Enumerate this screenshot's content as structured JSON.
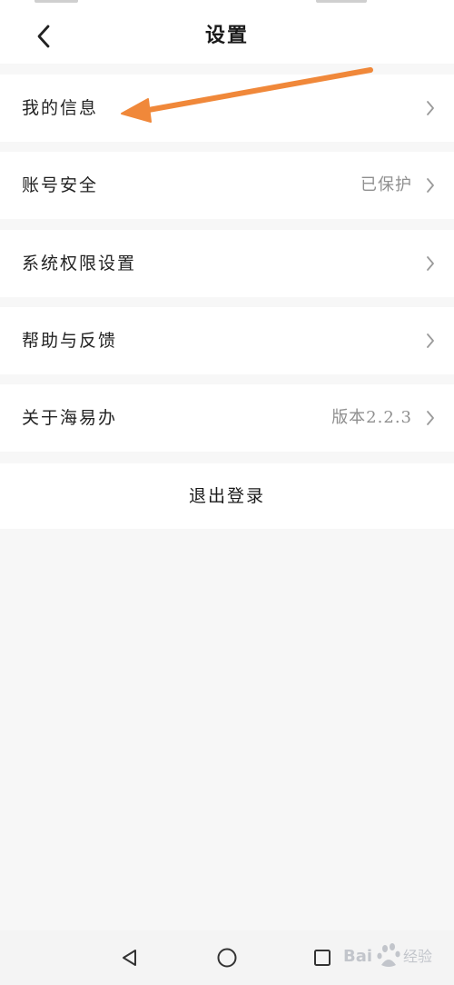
{
  "header": {
    "title": "设置",
    "back_icon": "chevron-left-icon"
  },
  "settings": [
    {
      "label": "我的信息",
      "value": "",
      "icon": "chevron-right-icon"
    },
    {
      "label": "账号安全",
      "value": "已保护",
      "icon": "chevron-right-icon"
    },
    {
      "label": "系统权限设置",
      "value": "",
      "icon": "chevron-right-icon"
    },
    {
      "label": "帮助与反馈",
      "value": "",
      "icon": "chevron-right-icon"
    },
    {
      "label": "关于海易办",
      "value": "版本2.2.3",
      "icon": "chevron-right-icon"
    }
  ],
  "logout": {
    "label": "退出登录"
  },
  "annotation": {
    "color": "#f0883a",
    "icon": "annotation-arrow-icon"
  },
  "navbar": {
    "back_icon": "triangle-back-icon",
    "home_icon": "circle-home-icon",
    "recent_icon": "square-recents-icon"
  },
  "watermark": {
    "text": "Bai 经验",
    "icon": "baidu-paw-logo"
  },
  "colors": {
    "page_bg": "#f7f7f7",
    "row_bg": "#ffffff",
    "secondary_text": "#8f8f8f"
  }
}
